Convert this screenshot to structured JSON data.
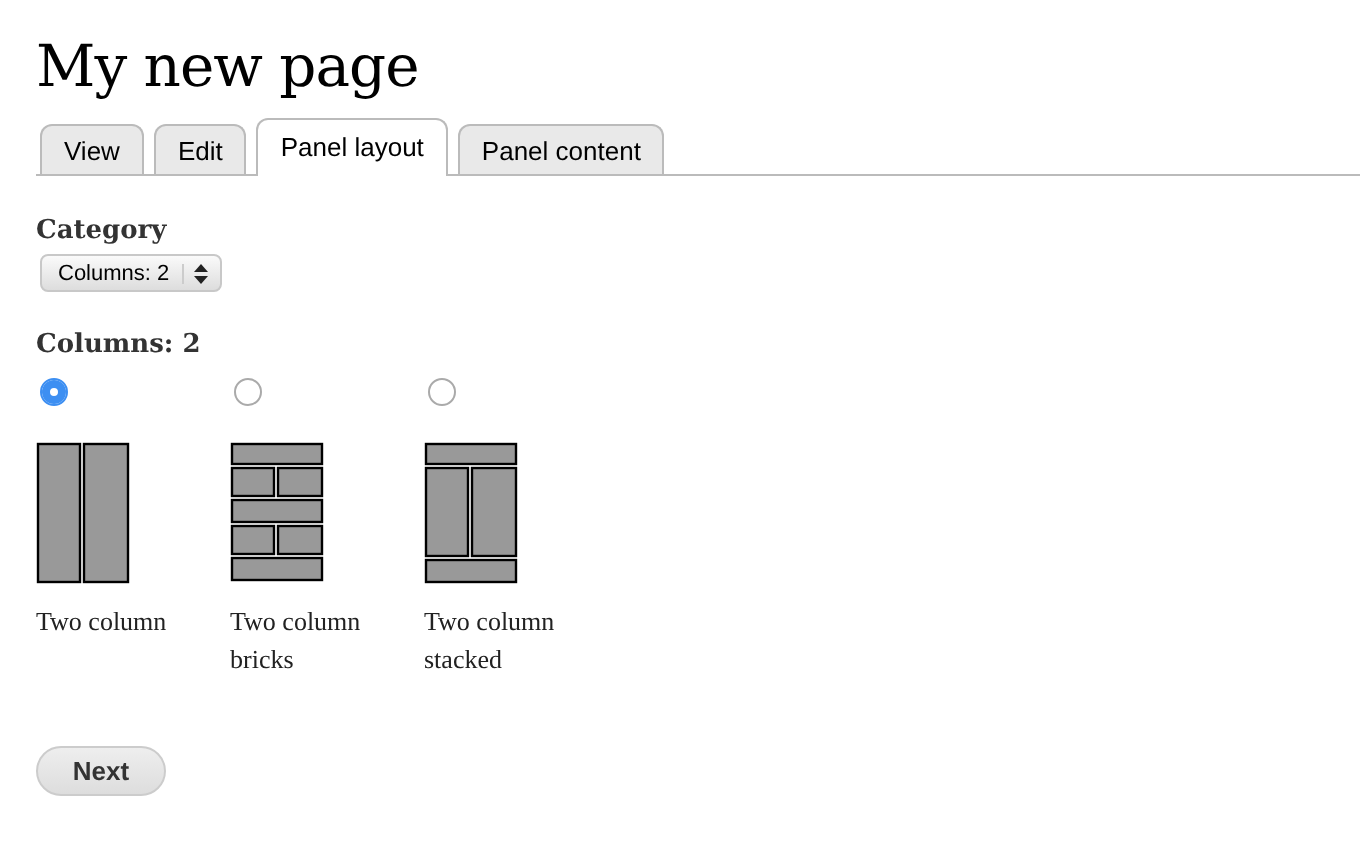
{
  "page_title": "My new page",
  "tabs": [
    {
      "label": "View",
      "selected": false
    },
    {
      "label": "Edit",
      "selected": false
    },
    {
      "label": "Panel layout",
      "selected": true
    },
    {
      "label": "Panel content",
      "selected": false
    }
  ],
  "category": {
    "label": "Category",
    "value": "Columns: 2"
  },
  "layouts": {
    "heading": "Columns: 2",
    "options": [
      {
        "kind": "columns",
        "label": "Two column",
        "selected": true
      },
      {
        "kind": "bricks",
        "label": "Two column bricks",
        "selected": false
      },
      {
        "kind": "stacked",
        "label": "Two column stacked",
        "selected": false
      }
    ]
  },
  "buttons": [
    "Next"
  ]
}
